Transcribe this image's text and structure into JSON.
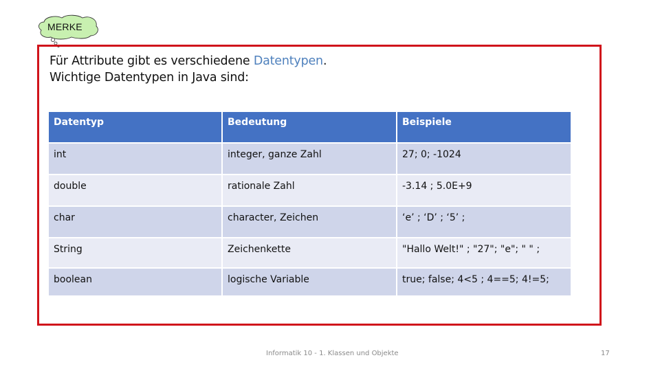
{
  "badge": {
    "label": "MERKE",
    "icon": "thought-bubble-icon",
    "fill_color": "#c8f0b0"
  },
  "intro": {
    "line1_before": "Für Attribute gibt es verschiedene ",
    "line1_highlight": "Datentypen",
    "line1_after": ".",
    "line2": "Wichtige Datentypen in Java sind:",
    "highlight_color": "#4f81bd"
  },
  "table": {
    "headers": [
      "Datentyp",
      "Bedeutung",
      "Beispiele"
    ],
    "rows": [
      [
        "int",
        "integer, ganze Zahl",
        "27; 0; -1024"
      ],
      [
        "double",
        "rationale Zahl",
        "-3.14 ; 5.0E+9"
      ],
      [
        "char",
        "character, Zeichen",
        "‘e’ ;  ‘D’ ; ‘5’ ;"
      ],
      [
        "String",
        "Zeichenkette",
        "\"Hallo Welt!\" ; \"27\"; \"e\"; \" \" ;"
      ],
      [
        "boolean",
        "logische Variable",
        "true; false; 4<5 ; 4==5; 4!=5;"
      ]
    ],
    "header_color": "#4472c4",
    "row_color_odd": "#cfd5ea",
    "row_color_even": "#e9ebf5"
  },
  "frame_color": "#d0141b",
  "footer": {
    "text": "Informatik 10 - 1. Klassen und Objekte",
    "page_number": "17"
  }
}
